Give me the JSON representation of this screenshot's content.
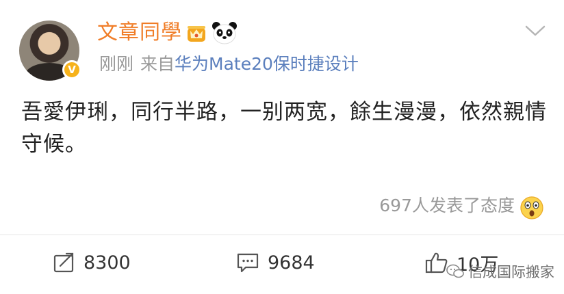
{
  "post": {
    "username": "文章同學",
    "time": "刚刚",
    "source_prefix": "来自",
    "device": "华为Mate20保时捷设计",
    "content": "吾愛伊琍，同行半路，一别两宽，餘生漫漫，依然親情守候。",
    "reactions": "697人发表了态度",
    "verified_badge": "V"
  },
  "actions": {
    "repost_count": "8300",
    "comment_count": "9684",
    "like_count": "10万"
  },
  "watermark": "信成国际搬家",
  "colors": {
    "username": "#f07d28",
    "link": "#5b7fbd",
    "muted": "#999999",
    "badge": "#f6b21b"
  }
}
